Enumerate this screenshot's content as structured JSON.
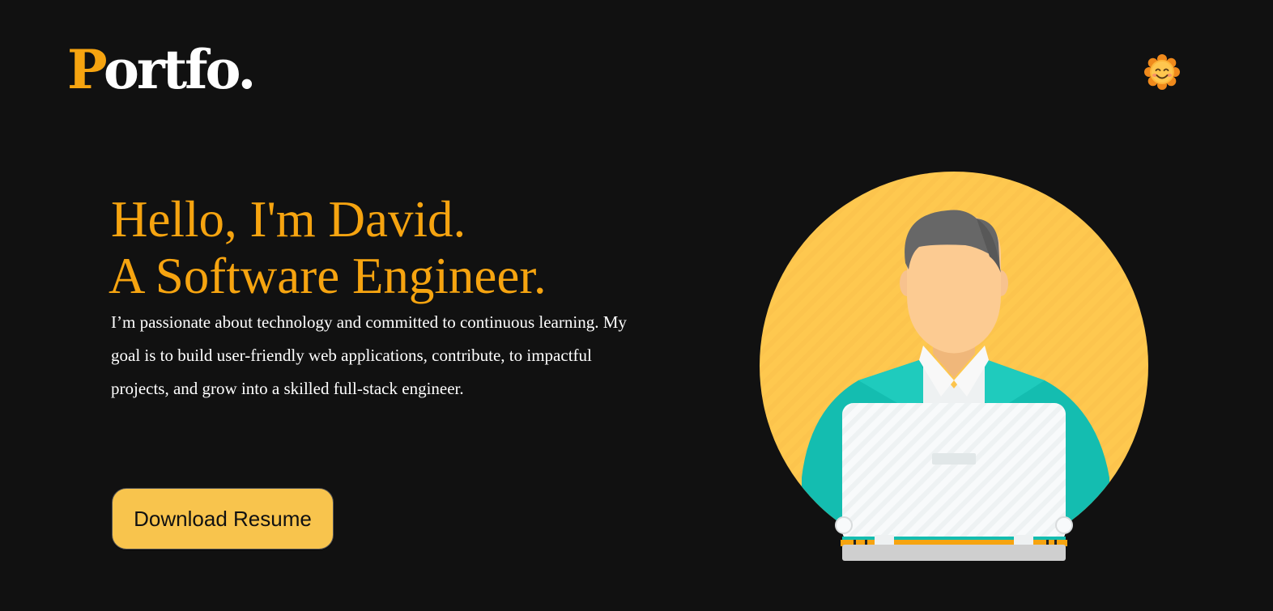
{
  "header": {
    "logo_initial": "P",
    "logo_rest": "ortfo.",
    "theme_toggle_icon": "smiling-sun-icon"
  },
  "hero": {
    "greeting": "Hello, I'm David.",
    "role": "A Software Engineer.",
    "intro": "I’m passionate about technology and committed to continuous learning. My goal is to build user-friendly web applications, contribute, to impactful projects, and grow into a skilled full-stack engineer.",
    "download_label": "Download Resume",
    "illustration_icon": "developer-laptop-illustration"
  },
  "colors": {
    "background": "#111111",
    "accent": "#f6a410",
    "button": "#f8c44d",
    "circle": "#fec84f",
    "teal": "#14bdb0"
  }
}
